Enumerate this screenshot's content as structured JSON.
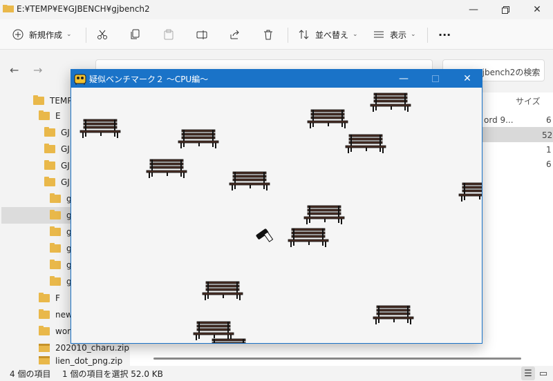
{
  "explorer": {
    "title": "E:¥TEMP¥E¥GJBENCH¥gjbench2",
    "toolbar": {
      "new_label": "新規作成",
      "sort_label": "並べ替え",
      "view_label": "表示",
      "more_label": "···"
    },
    "search_placeholder": "gjbench2の検索",
    "tree": [
      {
        "label": "TEMP"
      },
      {
        "label": "E"
      },
      {
        "label": "GJ"
      },
      {
        "label": "GJ"
      },
      {
        "label": "GJ"
      },
      {
        "label": "GJB"
      },
      {
        "label": "gj"
      },
      {
        "label": "gj"
      },
      {
        "label": "gj"
      },
      {
        "label": "gj"
      },
      {
        "label": "gj"
      },
      {
        "label": "gj"
      },
      {
        "label": "F"
      },
      {
        "label": "new"
      },
      {
        "label": "work"
      },
      {
        "label": "202010_charu.zip"
      },
      {
        "label": "lien_dot_png.zip"
      }
    ],
    "columns": {
      "size": "サイズ"
    },
    "peek": {
      "name": "ord 9...",
      "sizes": [
        "6",
        "52",
        "1",
        "6"
      ]
    },
    "status": {
      "count": "4 個の項目",
      "selected": "1 個の項目を選択  52.0 KB"
    }
  },
  "game_window": {
    "title": "疑似ベンチマーク２ ～CPU編～",
    "benches": [
      {
        "label": "bench-1"
      },
      {
        "label": "bench-2"
      },
      {
        "label": "bench-3"
      },
      {
        "label": "bench-4"
      },
      {
        "label": "bench-5"
      },
      {
        "label": "bench-6"
      },
      {
        "label": "bench-7"
      },
      {
        "label": "bench-8"
      },
      {
        "label": "bench-9"
      },
      {
        "label": "bench-10"
      },
      {
        "label": "bench-11"
      },
      {
        "label": "bench-12"
      },
      {
        "label": "bench-13"
      },
      {
        "label": "bench-14"
      }
    ]
  },
  "colors": {
    "titlebar_accent": "#1a73c8",
    "bench_wood": "#4a2e24",
    "folder": "#e9b84a"
  }
}
